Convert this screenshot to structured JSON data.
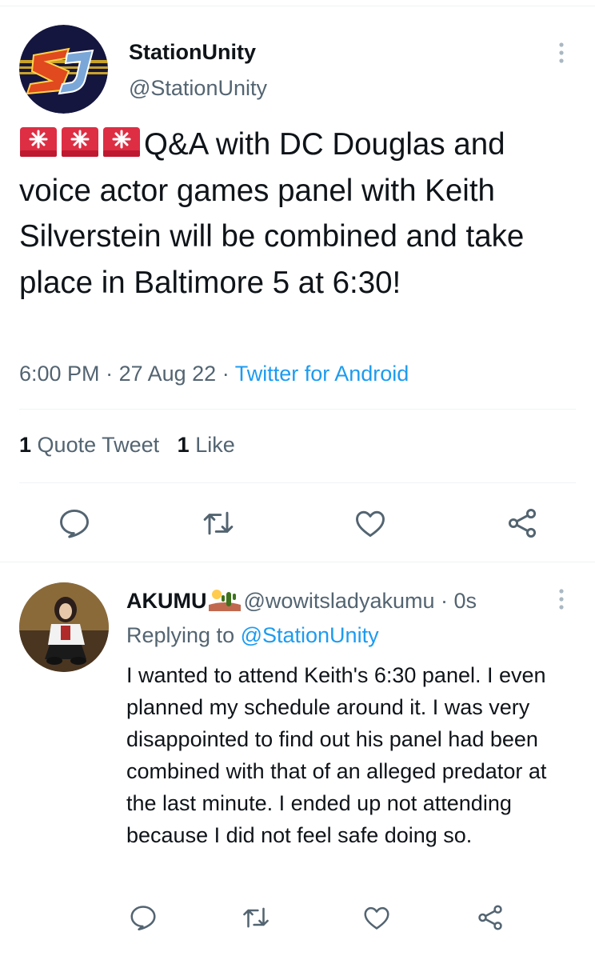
{
  "tweet": {
    "author_name": "StationUnity",
    "author_handle": "@StationUnity",
    "avatar_initials": "SU",
    "emoji": [
      "rotating-light",
      "rotating-light",
      "rotating-light"
    ],
    "text": "Q&A with DC Douglas and voice actor games panel with Keith Silverstein will be combined and take place in Baltimore 5 at 6:30!",
    "time": "6:00 PM",
    "dot1": " · ",
    "date": "27 Aug 22",
    "dot2": " · ",
    "source": "Twitter for Android",
    "stats": {
      "quote_count": "1",
      "quote_label": "Quote Tweet",
      "like_count": "1",
      "like_label": "Like"
    },
    "actions": [
      "reply-icon",
      "retweet-icon",
      "like-icon",
      "share-icon"
    ]
  },
  "reply": {
    "author_name": "AKUMU",
    "name_emoji": "desert-cactus",
    "author_handle": "@wowitsladyakumu",
    "dot": " · ",
    "age": "0s",
    "replying_prefix": "Replying to ",
    "replying_to": "@StationUnity",
    "text": "I wanted to attend Keith's 6:30 panel.  I even planned my schedule around it.  I was very disappointed to find out his panel had been combined with that of an alleged predator at the last minute.  I ended up not attending because I did not feel safe doing so.",
    "actions": [
      "reply-icon",
      "retweet-icon",
      "like-icon",
      "share-icon"
    ]
  },
  "colors": {
    "text": "#0f1419",
    "secondary": "#536471",
    "link": "#1d9bf0",
    "divider": "#eff3f4",
    "icon": "#536471"
  }
}
